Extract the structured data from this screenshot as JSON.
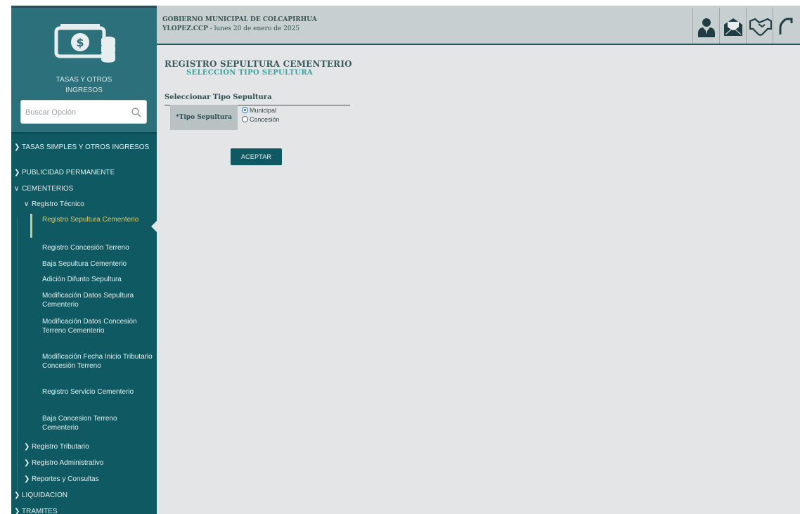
{
  "sidebar": {
    "logo_line1": "TASAS Y OTROS",
    "logo_line2": "INGRESOS",
    "search_placeholder": "Buscar Opción",
    "menu": [
      {
        "label": "TASAS SIMPLES Y OTROS INGRESOS",
        "level": 0
      },
      {
        "label": "PUBLICIDAD PERMANENTE",
        "level": 0
      },
      {
        "label": "CEMENTERIOS",
        "level": 0,
        "expanded": true
      },
      {
        "label": "Registro Técnico",
        "level": 1,
        "expanded": true
      },
      {
        "label": "Registro Sepultura Cementerio",
        "level": 2,
        "active": true
      },
      {
        "label": "Registro Concesión Terreno",
        "level": 2
      },
      {
        "label": "Baja Sepultura Cementerio",
        "level": 2
      },
      {
        "label": "Adición Difunto Sepultura",
        "level": 2
      },
      {
        "label": "Modificación Datos Sepultura Cementerio",
        "level": 2
      },
      {
        "label": "Modificación Datos Concesión Terreno Cementerio",
        "level": 2
      },
      {
        "label": "Modificación Fecha Inicio Tributario Concesión Terreno",
        "level": 2
      },
      {
        "label": "Registro Servicio Cementerio",
        "level": 2
      },
      {
        "label": "Baja Concesion Terreno Cementerio",
        "level": 2
      },
      {
        "label": "Registro Tributario",
        "level": 1
      },
      {
        "label": "Registro Administrativo",
        "level": 1
      },
      {
        "label": "Reportes y Consultas",
        "level": 1
      },
      {
        "label": "LIQUIDACION",
        "level": 0
      },
      {
        "label": "TRAMITES",
        "level": 0
      }
    ]
  },
  "header": {
    "title": "GOBIERNO MUNICIPAL DE COLCAPIRHUA",
    "user": "YLOPEZ.CCP",
    "date": " - lunes 20 de enero de 2025",
    "icons": [
      "user-icon",
      "mail-icon",
      "handshake-icon",
      "logout-icon"
    ]
  },
  "main": {
    "title": "REGISTRO SEPULTURA CEMENTERIO",
    "subtitle": "SELECCIÓN TIPO SEPULTURA",
    "section": "Seleccionar Tipo Sepultura",
    "field_label": "*Tipo Sepultura",
    "options": [
      {
        "label": "Municipal",
        "checked": true
      },
      {
        "label": "Concesión",
        "checked": false
      }
    ],
    "accept_label": "ACEPTAR"
  },
  "colors": {
    "sidebar": "#0f5a62",
    "header": "#c7cfd1",
    "content_bg": "#e3e5e6",
    "active": "#d8c96d",
    "subtitle": "#3aa39e"
  }
}
